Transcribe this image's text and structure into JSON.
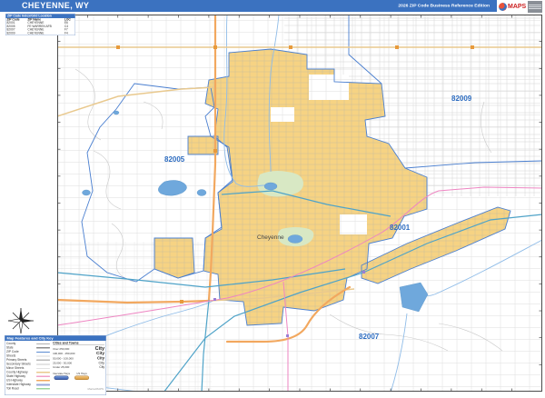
{
  "header": {
    "title": "CHEYENNE, WY",
    "edition": "2026 ZIP Code Business Reference Edition",
    "logo_brand": "MAPS"
  },
  "zip_table": {
    "title": "ZIP Code Index/Grid Location",
    "columns": [
      "ZIP Code",
      "ZIP Name",
      "LOC"
    ],
    "rows": [
      {
        "zip": "82001",
        "name": "CHEYENNE",
        "loc": "E6"
      },
      {
        "zip": "82005",
        "name": "FE WARREN AFB",
        "loc": "C4"
      },
      {
        "zip": "82007",
        "name": "CHEYENNE",
        "loc": "F7"
      },
      {
        "zip": "82009",
        "name": "CHEYENNE",
        "loc": "F4"
      }
    ]
  },
  "map": {
    "labels": {
      "zip82005": "82005",
      "zip82009": "82009",
      "zip82001": "82001",
      "zip82007": "82007",
      "city": "Cheyenne"
    }
  },
  "legend": {
    "title": "Map Features and City Key",
    "features": [
      {
        "label": "County",
        "color": "#b0b0b0"
      },
      {
        "label": "State",
        "color": "#8c8c8c"
      },
      {
        "label": "ZIP Code",
        "color": "#5b8bd0"
      },
      {
        "label": "Streets",
        "color": "#d9d9d9"
      },
      {
        "label": "Primary Streets",
        "color": "#b8b8b8"
      },
      {
        "label": "Secondary Streets",
        "color": "#c8c8c8"
      },
      {
        "label": "Minor Streets",
        "color": "#e2e2e2"
      },
      {
        "label": "County Highway",
        "color": "#e9c98e"
      },
      {
        "label": "State Highway",
        "color": "#f2a0c8"
      },
      {
        "label": "US Highway",
        "color": "#f2a85f"
      },
      {
        "label": "Interstate Highway",
        "color": "#9aa8dc"
      },
      {
        "label": "Toll Road",
        "color": "#9cd49c"
      }
    ],
    "cities": {
      "title": "Cities and Towns",
      "classes": [
        {
          "range": "Over 250,000",
          "sample": "City"
        },
        {
          "range": "100,000 - 250,000",
          "sample": "City"
        },
        {
          "range": "50,000 - 100,000",
          "sample": "City"
        },
        {
          "range": "25,000 - 50,000",
          "sample": "City"
        },
        {
          "range": "Under 25,000",
          "sample": "City"
        }
      ]
    },
    "shields": [
      {
        "label": "Interstate Hwys"
      },
      {
        "label": "US Hwys"
      }
    ],
    "watermark": "MarketMAPS"
  },
  "colors": {
    "header_blue": "#3b72c0",
    "zip_area_fill": "#f6d383",
    "zip_boundary_blue": "#4a7fd0",
    "zip_label_blue": "#2d6cc0",
    "interstate_orange": "#f2a85f",
    "county_road_tan": "#e9c98e",
    "railroad_pink": "#ee85c2",
    "water_blue": "#6fa8dc",
    "creek_blue": "#8fbce8",
    "park_green": "#d8e8c4",
    "major_road_teal": "#4fa3c8"
  }
}
